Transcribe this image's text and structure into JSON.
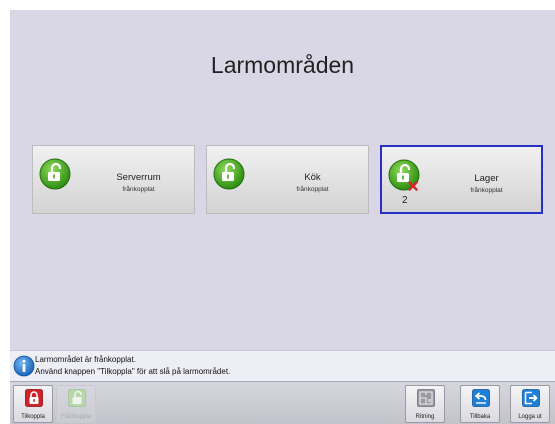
{
  "screen": {
    "title": "Larmområden"
  },
  "areas": [
    {
      "name": "Serverrum",
      "status": "frånkopplat",
      "count": "",
      "selected": false
    },
    {
      "name": "Kök",
      "status": "frånkopplat",
      "count": "",
      "selected": false
    },
    {
      "name": "Lager",
      "status": "frånkopplat",
      "count": "2",
      "selected": true
    }
  ],
  "info": {
    "line1": "Larmområdet är frånkopplat.",
    "line2": "Använd knappen \"Tilkoppla\" för att slå på larmområdet."
  },
  "toolbar": {
    "arm_label": "Tilkoppla",
    "disarm_label": "Frånkoppla",
    "view_label": "Ritning",
    "back_label": "Tillbaka",
    "logout_label": "Logga ut"
  },
  "colors": {
    "background": "#d9d7e6",
    "lock_green": "#3fa51a",
    "selection_border": "#2630c4",
    "arm_red": "#d0202a",
    "action_blue": "#1f7fd6",
    "fault_red": "#d8232a"
  },
  "icons": {
    "area_lock": "open-padlock-icon",
    "fault": "red-x-icon",
    "info": "info-icon",
    "arm": "closed-padlock-icon",
    "disarm": "open-padlock-icon",
    "view": "floorplan-icon",
    "back": "back-arrow-icon",
    "logout": "logout-arrow-icon"
  }
}
